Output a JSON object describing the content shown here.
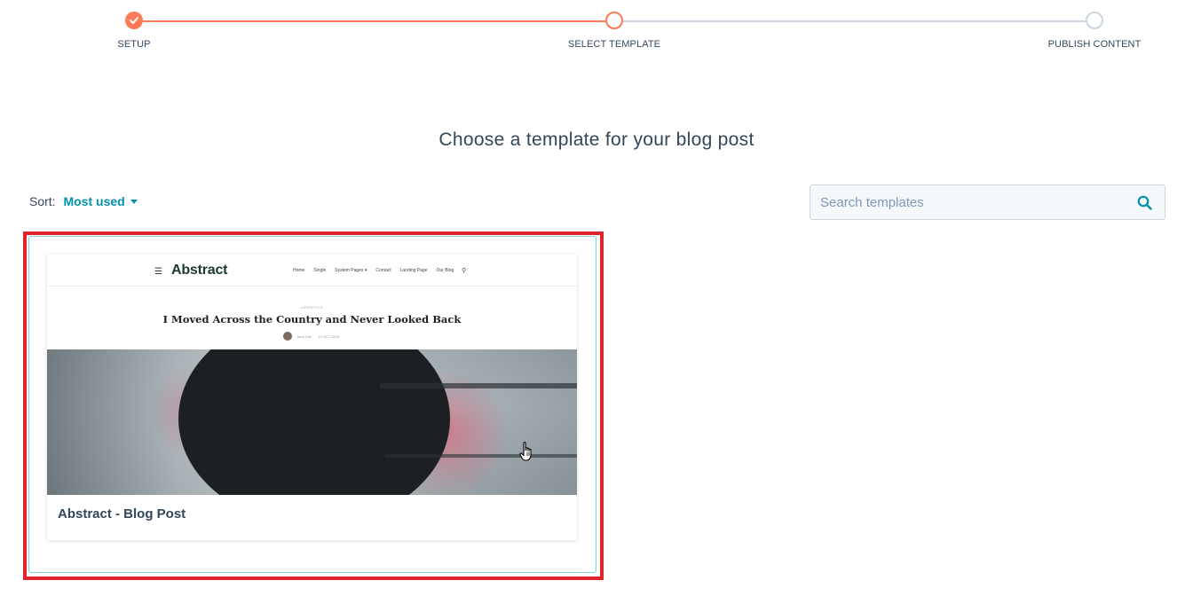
{
  "stepper": {
    "steps": [
      {
        "label": "SETUP",
        "state": "done"
      },
      {
        "label": "SELECT TEMPLATE",
        "state": "active"
      },
      {
        "label": "PUBLISH CONTENT",
        "state": "todo"
      }
    ]
  },
  "page": {
    "title": "Choose a template for your blog post"
  },
  "sort": {
    "label": "Sort:",
    "value": "Most used"
  },
  "search": {
    "placeholder": "Search templates"
  },
  "templates": [
    {
      "name": "Abstract - Blog Post",
      "preview": {
        "logo": "Abstract",
        "nav": [
          "Home",
          "Single",
          "System Pages ▾",
          "Contact",
          "Landing Page",
          "Our Blog"
        ],
        "category": "LIFESTYLE",
        "title": "I Moved Across the Country and Never Looked Back",
        "author": "Jane Doe",
        "date": "10 OCT 2019"
      }
    }
  ],
  "colors": {
    "accent": "#ff7a59",
    "link": "#0091ae",
    "selection": "#e0242c"
  }
}
